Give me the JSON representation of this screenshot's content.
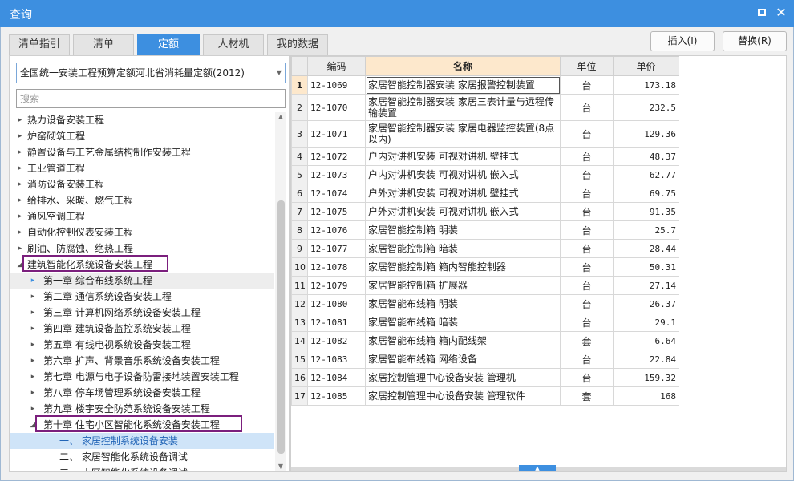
{
  "window": {
    "title": "查询"
  },
  "tabs": [
    {
      "label": "清单指引",
      "active": false
    },
    {
      "label": "清单",
      "active": false
    },
    {
      "label": "定额",
      "active": true
    },
    {
      "label": "人材机",
      "active": false
    },
    {
      "label": "我的数据",
      "active": false
    }
  ],
  "actions": {
    "insert_label": "插入(I)",
    "replace_label": "替换(R)"
  },
  "library": {
    "selected": "全国统一安装工程预算定额河北省消耗量定额(2012)"
  },
  "search": {
    "placeholder": "搜索"
  },
  "tree": [
    {
      "label": "热力设备安装工程",
      "caret": "▸"
    },
    {
      "label": "炉窑砌筑工程",
      "caret": "▸"
    },
    {
      "label": "静置设备与工艺金属结构制作安装工程",
      "caret": "▸"
    },
    {
      "label": "工业管道工程",
      "caret": "▸"
    },
    {
      "label": "消防设备安装工程",
      "caret": "▸"
    },
    {
      "label": "给排水、采暖、燃气工程",
      "caret": "▸"
    },
    {
      "label": "通风空调工程",
      "caret": "▸"
    },
    {
      "label": "自动化控制仪表安装工程",
      "caret": "▸"
    },
    {
      "label": "刷油、防腐蚀、绝热工程",
      "caret": "▸"
    },
    {
      "label": "建筑智能化系统设备安装工程",
      "caret": "◢"
    },
    {
      "label": "第一章 综合布线系统工程",
      "caret": "▸"
    },
    {
      "label": "第二章 通信系统设备安装工程",
      "caret": "▸"
    },
    {
      "label": "第三章 计算机网络系统设备安装工程",
      "caret": "▸"
    },
    {
      "label": "第四章 建筑设备监控系统安装工程",
      "caret": "▸"
    },
    {
      "label": "第五章 有线电视系统设备安装工程",
      "caret": "▸"
    },
    {
      "label": "第六章 扩声、背景音乐系统设备安装工程",
      "caret": "▸"
    },
    {
      "label": "第七章 电源与电子设备防雷接地装置安装工程",
      "caret": "▸"
    },
    {
      "label": "第八章 停车场管理系统设备安装工程",
      "caret": "▸"
    },
    {
      "label": "第九章 楼宇安全防范系统设备安装工程",
      "caret": "▸"
    },
    {
      "label": "第十章 住宅小区智能化系统设备安装工程",
      "caret": "◢"
    },
    {
      "label": "一、 家居控制系统设备安装",
      "caret": ""
    },
    {
      "label": "二、 家居智能化系统设备调试",
      "caret": ""
    },
    {
      "label": "三、 小区智能化系统设备调试",
      "caret": ""
    }
  ],
  "table": {
    "headers": [
      "编码",
      "名称",
      "单位",
      "单价"
    ],
    "rows": [
      {
        "idx": "1",
        "code": "12-1069",
        "name": "家居智能控制器安装 家居报警控制装置",
        "unit": "台",
        "price": "173.18"
      },
      {
        "idx": "2",
        "code": "12-1070",
        "name": "家居智能控制器安装 家居三表计量与远程传输装置",
        "unit": "台",
        "price": "232.5"
      },
      {
        "idx": "3",
        "code": "12-1071",
        "name": "家居智能控制器安装 家居电器监控装置(8点以内)",
        "unit": "台",
        "price": "129.36"
      },
      {
        "idx": "4",
        "code": "12-1072",
        "name": "户内对讲机安装 可视对讲机 壁挂式",
        "unit": "台",
        "price": "48.37"
      },
      {
        "idx": "5",
        "code": "12-1073",
        "name": "户内对讲机安装 可视对讲机 嵌入式",
        "unit": "台",
        "price": "62.77"
      },
      {
        "idx": "6",
        "code": "12-1074",
        "name": "户外对讲机安装 可视对讲机 壁挂式",
        "unit": "台",
        "price": "69.75"
      },
      {
        "idx": "7",
        "code": "12-1075",
        "name": "户外对讲机安装 可视对讲机 嵌入式",
        "unit": "台",
        "price": "91.35"
      },
      {
        "idx": "8",
        "code": "12-1076",
        "name": "家居智能控制箱 明装",
        "unit": "台",
        "price": "25.7"
      },
      {
        "idx": "9",
        "code": "12-1077",
        "name": "家居智能控制箱 暗装",
        "unit": "台",
        "price": "28.44"
      },
      {
        "idx": "10",
        "code": "12-1078",
        "name": "家居智能控制箱 箱内智能控制器",
        "unit": "台",
        "price": "50.31"
      },
      {
        "idx": "11",
        "code": "12-1079",
        "name": "家居智能控制箱 扩展器",
        "unit": "台",
        "price": "27.14"
      },
      {
        "idx": "12",
        "code": "12-1080",
        "name": "家居智能布线箱 明装",
        "unit": "台",
        "price": "26.37"
      },
      {
        "idx": "13",
        "code": "12-1081",
        "name": "家居智能布线箱 暗装",
        "unit": "台",
        "price": "29.1"
      },
      {
        "idx": "14",
        "code": "12-1082",
        "name": "家居智能布线箱 箱内配线架",
        "unit": "套",
        "price": "6.64"
      },
      {
        "idx": "15",
        "code": "12-1083",
        "name": "家居智能布线箱 网络设备",
        "unit": "台",
        "price": "22.84"
      },
      {
        "idx": "16",
        "code": "12-1084",
        "name": "家居控制管理中心设备安装 管理机",
        "unit": "台",
        "price": "159.32"
      },
      {
        "idx": "17",
        "code": "12-1085",
        "name": "家居控制管理中心设备安装 管理软件",
        "unit": "套",
        "price": "168"
      }
    ]
  },
  "colors": {
    "accent": "#3d8fe0",
    "highlight_box": "#7b1f7d",
    "selected_row": "#cfe4f8",
    "name_header": "#fde8cc"
  }
}
